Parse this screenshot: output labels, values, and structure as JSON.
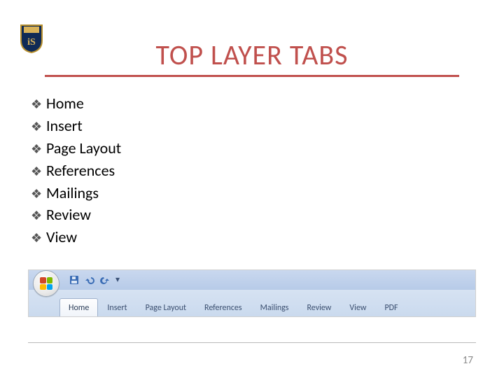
{
  "title": "TOP LAYER TABS",
  "page_number": "17",
  "colors": {
    "accent": "#C0504D"
  },
  "bullet_glyph": "❖",
  "bullets": [
    "Home",
    "Insert",
    "Page Layout",
    "References",
    "Mailings",
    "Review",
    "View"
  ],
  "ribbon": {
    "qat": {
      "save_tooltip": "Save",
      "undo_tooltip": "Undo",
      "redo_tooltip": "Redo"
    },
    "tabs": [
      {
        "label": "Home",
        "active": true
      },
      {
        "label": "Insert",
        "active": false
      },
      {
        "label": "Page Layout",
        "active": false
      },
      {
        "label": "References",
        "active": false
      },
      {
        "label": "Mailings",
        "active": false
      },
      {
        "label": "Review",
        "active": false
      },
      {
        "label": "View",
        "active": false
      },
      {
        "label": "PDF",
        "active": false
      }
    ]
  }
}
